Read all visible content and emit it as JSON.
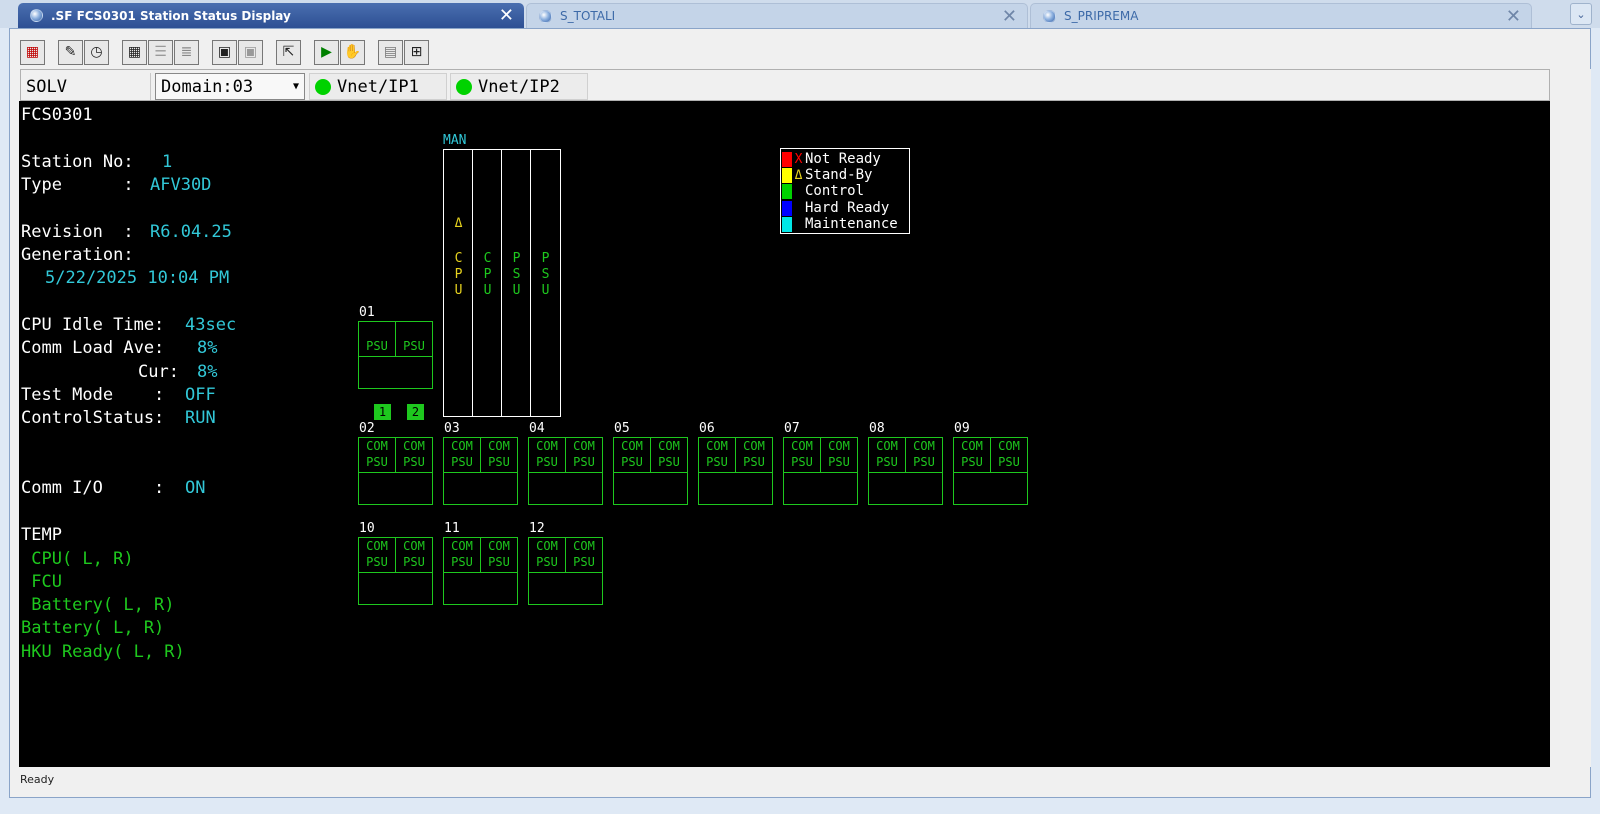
{
  "tabs": [
    {
      "label": ".SF FCS0301  Station Status Display",
      "active": true
    },
    {
      "label": "S_TOTALI",
      "active": false
    },
    {
      "label": "S_PRIPREMA",
      "active": false
    }
  ],
  "domain_bar": {
    "station": "SOLV",
    "domain": "Domain:03",
    "vnet1": "Vnet/IP1",
    "vnet2": "Vnet/IP2"
  },
  "info": {
    "station_name": "FCS0301",
    "station_no_label": "Station No:",
    "station_no": "1",
    "type_label": "Type      :",
    "type": "AFV30D",
    "revision_label": "Revision  :",
    "revision": "R6.04.25",
    "generation_label": "Generation:",
    "generation": "5/22/2025 10:04 PM",
    "cpu_idle_label": "CPU Idle Time:",
    "cpu_idle": "43sec",
    "comm_load_label": "Comm Load Ave:",
    "comm_load_ave": "8%",
    "cur_label": "Cur:",
    "comm_load_cur": "8%",
    "test_mode_label": "Test Mode    :",
    "test_mode": "OFF",
    "control_status_label": "ControlStatus:",
    "control_status": "RUN",
    "comm_io_label": "Comm I/O     :",
    "comm_io": "ON",
    "temp_label": "TEMP",
    "temp_cpu": " CPU( L, R)",
    "temp_fcu": " FCU",
    "temp_battery": " Battery( L, R)",
    "battery": "Battery( L, R)",
    "hku_ready": "HKU Ready( L, R)"
  },
  "rack": {
    "mode_label": "MAN",
    "columns": [
      {
        "text": "C\nP\nU",
        "standby": true,
        "symbol": "Δ"
      },
      {
        "text": "C\nP\nU",
        "standby": false
      },
      {
        "text": "P\nS\nU",
        "standby": false
      },
      {
        "text": "P\nS\nU",
        "standby": false
      }
    ]
  },
  "legend": [
    {
      "color": "#ff0000",
      "symbol": "X",
      "symbol_color": "#ff0000",
      "label": "Not Ready"
    },
    {
      "color": "#ffff00",
      "symbol": "Δ",
      "symbol_color": "#e6d21e",
      "label": "Stand-By"
    },
    {
      "color": "#00d200",
      "symbol": "",
      "label": "Control"
    },
    {
      "color": "#0000ff",
      "symbol": "",
      "label": "Hard Ready"
    },
    {
      "color": "#00e6e6",
      "symbol": "",
      "label": "Maintenance"
    }
  ],
  "badges": [
    "1",
    "2"
  ],
  "nodes": [
    {
      "no": "01",
      "left": "PSU",
      "right": "PSU"
    },
    {
      "no": "02",
      "left": "COM\nPSU",
      "right": "COM\nPSU"
    },
    {
      "no": "03",
      "left": "COM\nPSU",
      "right": "COM\nPSU"
    },
    {
      "no": "04",
      "left": "COM\nPSU",
      "right": "COM\nPSU"
    },
    {
      "no": "05",
      "left": "COM\nPSU",
      "right": "COM\nPSU"
    },
    {
      "no": "06",
      "left": "COM\nPSU",
      "right": "COM\nPSU"
    },
    {
      "no": "07",
      "left": "COM\nPSU",
      "right": "COM\nPSU"
    },
    {
      "no": "08",
      "left": "COM\nPSU",
      "right": "COM\nPSU"
    },
    {
      "no": "09",
      "left": "COM\nPSU",
      "right": "COM\nPSU"
    },
    {
      "no": "10",
      "left": "COM\nPSU",
      "right": "COM\nPSU"
    },
    {
      "no": "11",
      "left": "COM\nPSU",
      "right": "COM\nPSU"
    },
    {
      "no": "12",
      "left": "COM\nPSU",
      "right": "COM\nPSU"
    }
  ],
  "toolbar": {
    "icons": [
      "alarm-icon",
      "edit-icon",
      "clock-icon",
      "grid-icon",
      "list-icon",
      "list-detail-icon",
      "save-icon",
      "save-multi-icon",
      "export-icon",
      "play-icon",
      "stop-hand-icon",
      "panel-icon",
      "tree-icon"
    ]
  },
  "status_bar": {
    "text": "Ready"
  }
}
